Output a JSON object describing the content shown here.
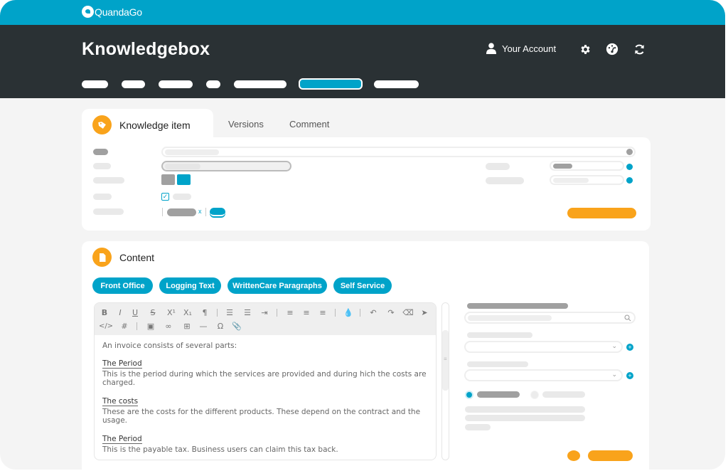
{
  "brand": {
    "name": "QuandaGo",
    "primary_color": "#00a3c9",
    "accent_color": "#f9a31b",
    "header_color": "#2a3134"
  },
  "header": {
    "title": "Knowledgebox",
    "account_label": "Your Account",
    "icons": [
      "user-icon",
      "gear-icon",
      "dashboard-icon",
      "refresh-icon"
    ],
    "nav_items": [
      {
        "label": "",
        "active": false
      },
      {
        "label": "",
        "active": false
      },
      {
        "label": "",
        "active": false
      },
      {
        "label": "",
        "active": false
      },
      {
        "label": "",
        "active": false
      },
      {
        "label": "",
        "active": true
      },
      {
        "label": "",
        "active": false
      }
    ]
  },
  "tabs": [
    {
      "label": "Knowledge item",
      "active": true,
      "icon": "tag-icon"
    },
    {
      "label": "Versions",
      "active": false
    },
    {
      "label": "Comment",
      "active": false
    }
  ],
  "content": {
    "title": "Content",
    "icon": "document-icon",
    "categories": [
      "Front Office",
      "Logging Text",
      "WrittenCare Paragraphs",
      "Self Service"
    ],
    "toolbar": {
      "row1": [
        "bold",
        "italic",
        "underline",
        "strikethrough",
        "superscript",
        "subscript",
        "paragraph",
        "ordered-list",
        "unordered-list",
        "indent",
        "align-left",
        "align-center",
        "align-right",
        "color",
        "undo",
        "redo",
        "eraser",
        "select"
      ],
      "row2": [
        "code",
        "hashtag",
        "image",
        "link",
        "table",
        "horizontal-rule",
        "special-char",
        "attachment"
      ]
    },
    "editor": {
      "intro": "An invoice consists of several parts:",
      "sections": [
        {
          "heading": "The Period",
          "text": "This is the period during which the services are provided and during hich the costs are charged."
        },
        {
          "heading": "The costs",
          "text": "These are the costs for the different products. These depend on the contract and the usage."
        },
        {
          "heading": "The Period",
          "text": "This is the payable tax. Business users can claim this tax back."
        }
      ]
    }
  }
}
